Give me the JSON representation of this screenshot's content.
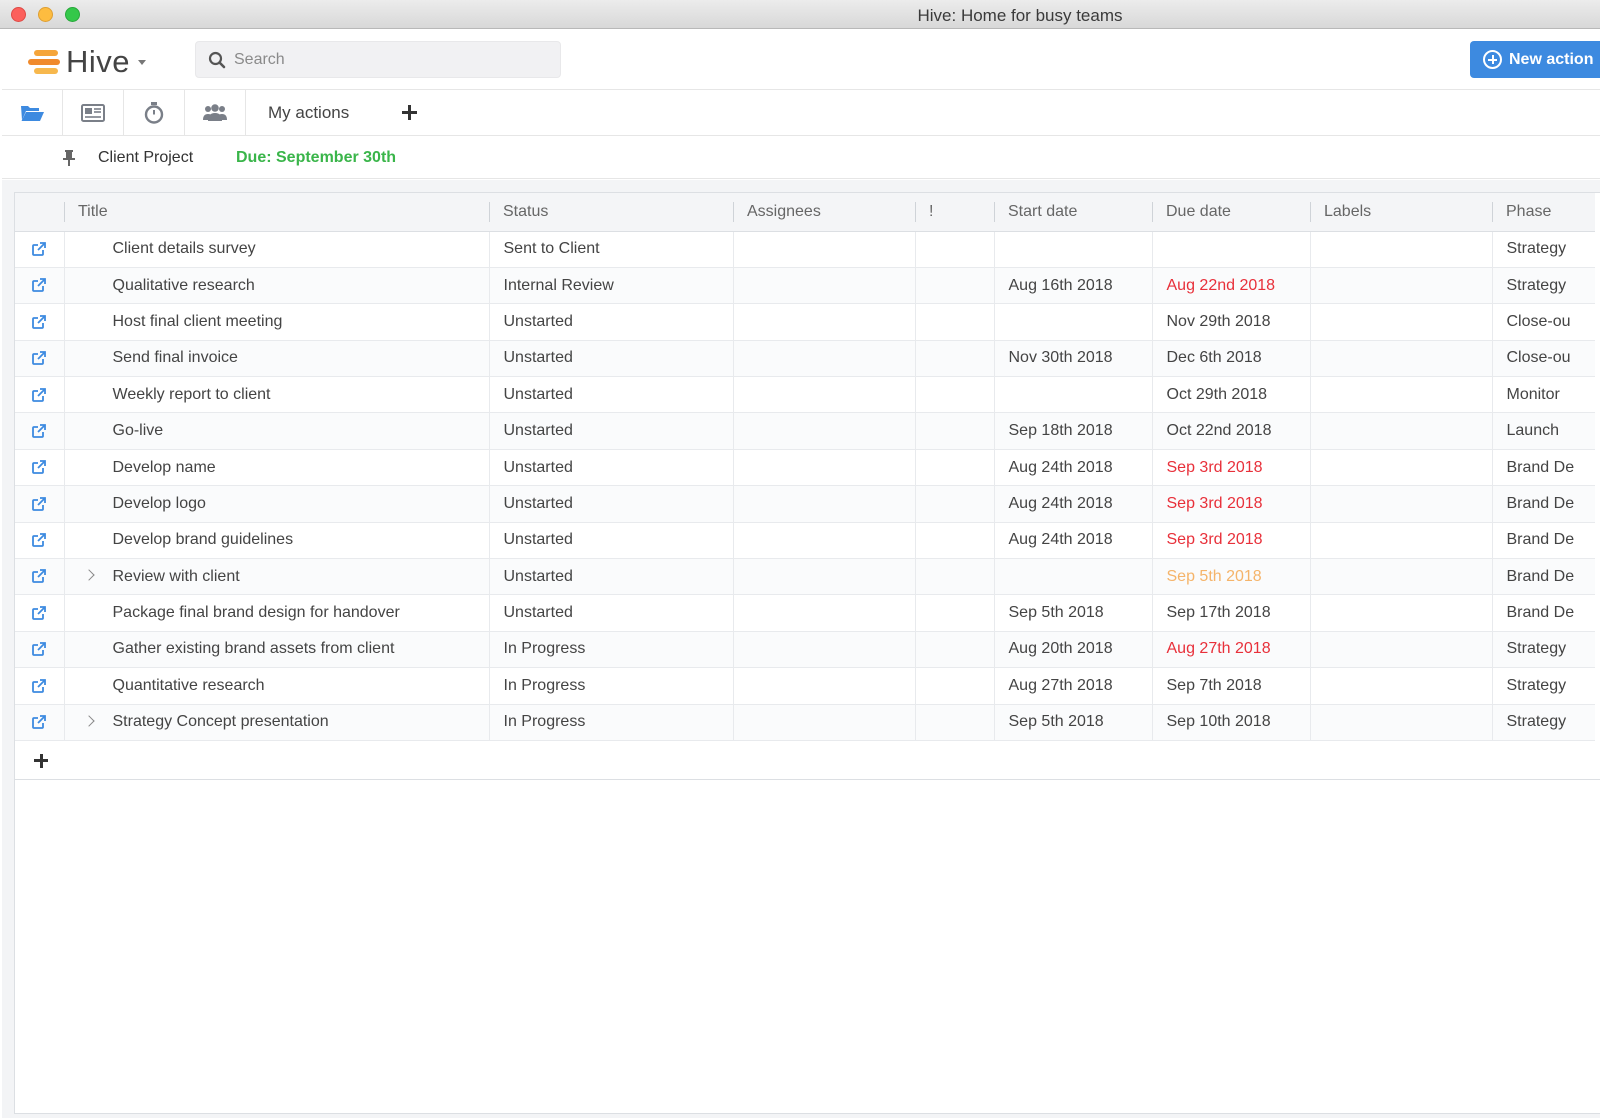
{
  "window": {
    "title": "Hive: Home for busy teams"
  },
  "header": {
    "logo_text": "Hive",
    "search_placeholder": "Search",
    "new_action_label": "New action"
  },
  "toolbar": {
    "icons": [
      "folder-open-icon",
      "newspaper-icon",
      "stopwatch-icon",
      "users-icon"
    ],
    "tab_my_actions": "My actions"
  },
  "project": {
    "name": "Client Project",
    "due": "Due: September 30th"
  },
  "colors": {
    "accent_blue": "#3d8ae0",
    "due_green": "#3ab54a",
    "overdue_red": "#e8303a",
    "due_soon_orange": "#f5b46a",
    "logo_orange": "#f08a2b"
  },
  "table": {
    "columns": [
      "",
      "Title",
      "Status",
      "Assignees",
      "!",
      "Start date",
      "Due date",
      "Labels",
      "Phase"
    ],
    "rows": [
      {
        "title": "Client details survey",
        "status": "Sent to Client",
        "start": "",
        "due": "",
        "due_state": "normal",
        "phase": "Strategy",
        "expandable": false
      },
      {
        "title": "Qualitative research",
        "status": "Internal Review",
        "start": "Aug 16th 2018",
        "due": "Aug 22nd 2018",
        "due_state": "overdue",
        "phase": "Strategy",
        "expandable": false
      },
      {
        "title": "Host final client meeting",
        "status": "Unstarted",
        "start": "",
        "due": "Nov 29th 2018",
        "due_state": "normal",
        "phase": "Close-ou",
        "expandable": false
      },
      {
        "title": "Send final invoice",
        "status": "Unstarted",
        "start": "Nov 30th 2018",
        "due": "Dec 6th 2018",
        "due_state": "normal",
        "phase": "Close-ou",
        "expandable": false
      },
      {
        "title": "Weekly report to client",
        "status": "Unstarted",
        "start": "",
        "due": "Oct 29th 2018",
        "due_state": "normal",
        "phase": "Monitor",
        "expandable": false
      },
      {
        "title": "Go-live",
        "status": "Unstarted",
        "start": "Sep 18th 2018",
        "due": "Oct 22nd 2018",
        "due_state": "normal",
        "phase": "Launch",
        "expandable": false
      },
      {
        "title": "Develop name",
        "status": "Unstarted",
        "start": "Aug 24th 2018",
        "due": "Sep 3rd 2018",
        "due_state": "overdue",
        "phase": "Brand De",
        "expandable": false
      },
      {
        "title": "Develop logo",
        "status": "Unstarted",
        "start": "Aug 24th 2018",
        "due": "Sep 3rd 2018",
        "due_state": "overdue",
        "phase": "Brand De",
        "expandable": false
      },
      {
        "title": "Develop brand guidelines",
        "status": "Unstarted",
        "start": "Aug 24th 2018",
        "due": "Sep 3rd 2018",
        "due_state": "overdue",
        "phase": "Brand De",
        "expandable": false
      },
      {
        "title": "Review with client",
        "status": "Unstarted",
        "start": "",
        "due": "Sep 5th 2018",
        "due_state": "soon",
        "phase": "Brand De",
        "expandable": true
      },
      {
        "title": "Package final brand design for handover",
        "status": "Unstarted",
        "start": "Sep 5th 2018",
        "due": "Sep 17th 2018",
        "due_state": "normal",
        "phase": "Brand De",
        "expandable": false
      },
      {
        "title": "Gather existing brand assets from client",
        "status": "In Progress",
        "start": "Aug 20th 2018",
        "due": "Aug 27th 2018",
        "due_state": "overdue",
        "phase": "Strategy",
        "expandable": false
      },
      {
        "title": "Quantitative research",
        "status": "In Progress",
        "start": "Aug 27th 2018",
        "due": "Sep 7th 2018",
        "due_state": "normal",
        "phase": "Strategy",
        "expandable": false
      },
      {
        "title": "Strategy Concept presentation",
        "status": "In Progress",
        "start": "Sep 5th 2018",
        "due": "Sep 10th 2018",
        "due_state": "normal",
        "phase": "Strategy",
        "expandable": true
      }
    ]
  }
}
